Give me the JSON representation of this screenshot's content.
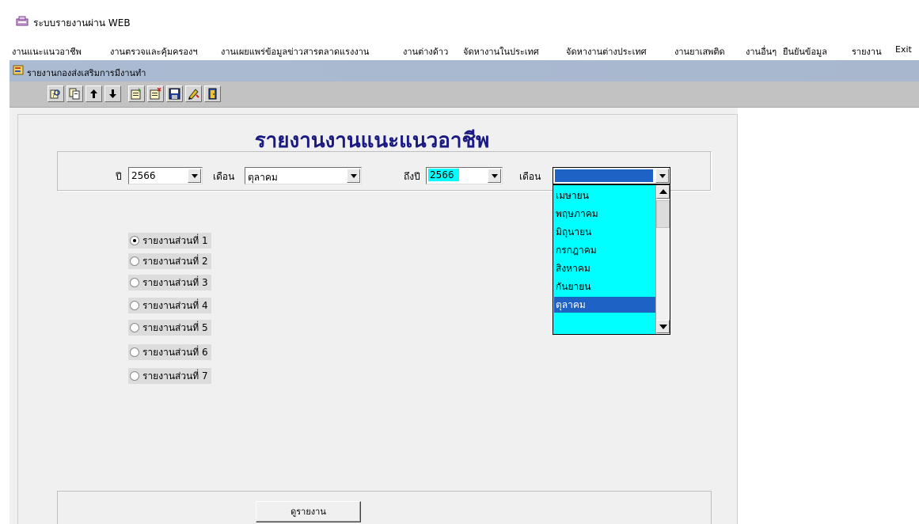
{
  "window": {
    "title": "ระบบรายงานผ่าน WEB"
  },
  "menu": {
    "items": [
      "งานแนะแนวอาชีพ",
      "งานตรวจและคุ้มครองฯ",
      "งานเผยแพร่ข้อมูลข่าวสารตลาดแรงงาน",
      "งานต่างด้าว",
      "จัดหางานในประเทศ",
      "จัดหางานต่างประเทศ",
      "งานยาเสพติด",
      "งานอื่นๆ",
      "ยืนยันข้อมูล",
      "รายงาน",
      "Exit"
    ]
  },
  "mdi": {
    "title": "รายงานกองส่งเสริมการมีงานทำ"
  },
  "toolbar": {
    "buttons": [
      "find-icon",
      "copy-icon",
      "arrow-up-icon",
      "arrow-down-icon",
      "add-record-icon",
      "delete-record-icon",
      "save-icon",
      "edit-icon",
      "exit-door-icon"
    ]
  },
  "form": {
    "title": "รายงานงานแนะแนวอาชีพ",
    "filters": {
      "year_label": "ปี",
      "year_value": "2566",
      "month_label": "เดือน",
      "month_value": "ตุลาคม",
      "to_year_label": "ถึงปี",
      "to_year_value": "2566",
      "to_month_label": "เดือน",
      "to_month_value": ""
    },
    "dropdown_options": [
      "เมษายน",
      "พฤษภาคม",
      "มิถุนายน",
      "กรกฎาคม",
      "สิงหาคม",
      "กันยายน",
      "ตุลาคม",
      ""
    ],
    "dropdown_selected": "ตุลาคม",
    "report_parts": [
      "รายงานส่วนที่ 1",
      "รายงานส่วนที่ 2",
      "รายงานส่วนที่ 3",
      "รายงานส่วนที่ 4",
      "รายงานส่วนที่ 5",
      "รายงานส่วนที่ 6",
      "รายงานส่วนที่ 7"
    ],
    "selected_part": "รายงานส่วนที่ 1",
    "view_button": "ดูรายงาน"
  },
  "colors": {
    "title_text": "#1a1a80",
    "dropdown_bg": "#00ffff",
    "selection": "#1d62c4",
    "caption_bar": "#aabbd2"
  }
}
